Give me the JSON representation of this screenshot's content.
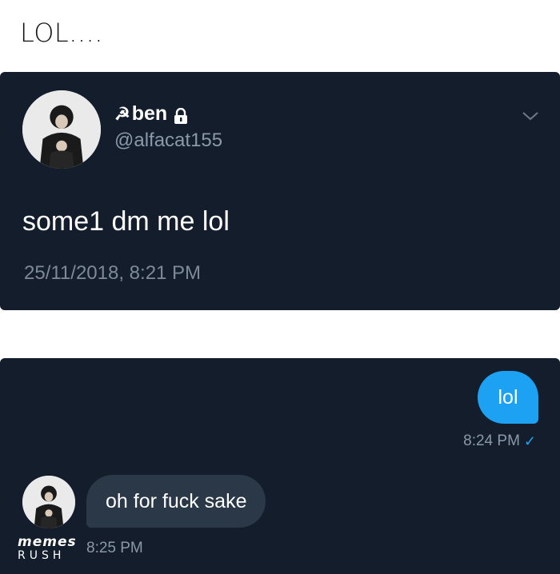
{
  "caption": "LOL....",
  "tweet": {
    "name_prefix": "☭",
    "display_name": "ben",
    "handle": "@alfacat155",
    "text": "some1 dm me lol",
    "timestamp": "25/11/2018, 8:21 PM",
    "icons": [
      "lock-icon",
      "chevron-down-icon"
    ]
  },
  "dm": {
    "outgoing": {
      "text": "lol",
      "time": "8:24 PM",
      "status": "✓"
    },
    "incoming": {
      "text": "oh for fuck sake",
      "time": "8:25 PM"
    }
  },
  "watermark": {
    "line1": "memes",
    "line2": "RUSH"
  },
  "colors": {
    "panel_bg": "#141d2b",
    "outgoing_bubble": "#1da1f2",
    "incoming_bubble": "#2a3848",
    "muted_text": "#8a99aa"
  }
}
